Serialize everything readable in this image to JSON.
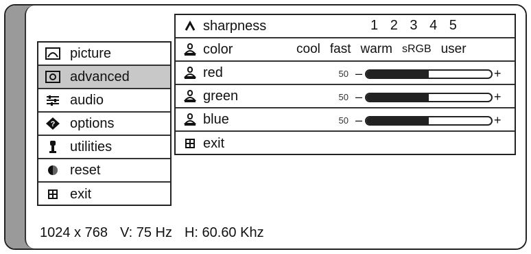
{
  "main_menu": {
    "items": [
      {
        "label": "picture",
        "icon": "picture-icon"
      },
      {
        "label": "advanced",
        "icon": "advanced-icon",
        "selected": true
      },
      {
        "label": "audio",
        "icon": "audio-icon"
      },
      {
        "label": "options",
        "icon": "options-icon"
      },
      {
        "label": "utilities",
        "icon": "utilities-icon"
      },
      {
        "label": "reset",
        "icon": "reset-icon"
      },
      {
        "label": "exit",
        "icon": "exit-icon"
      }
    ]
  },
  "advanced_menu": {
    "sharpness": {
      "label": "sharpness",
      "levels": [
        "1",
        "2",
        "3",
        "4",
        "5"
      ]
    },
    "color": {
      "label": "color",
      "options": [
        "cool",
        "fast",
        "warm",
        "sRGB",
        "user"
      ]
    },
    "red": {
      "label": "red",
      "value": "50",
      "minus": "–",
      "plus": "+",
      "level": 0.5
    },
    "green": {
      "label": "green",
      "value": "50",
      "minus": "–",
      "plus": "+",
      "level": 0.5
    },
    "blue": {
      "label": "blue",
      "value": "50",
      "minus": "–",
      "plus": "+",
      "level": 0.5
    },
    "exit": {
      "label": "exit"
    }
  },
  "status": {
    "resolution": "1024 x 768",
    "vertical": "V: 75 Hz",
    "horizontal": "H: 60.60 Khz"
  },
  "colors": {
    "selected_bg": "#c8c8c8",
    "frame_band": "#9a9a9a"
  }
}
